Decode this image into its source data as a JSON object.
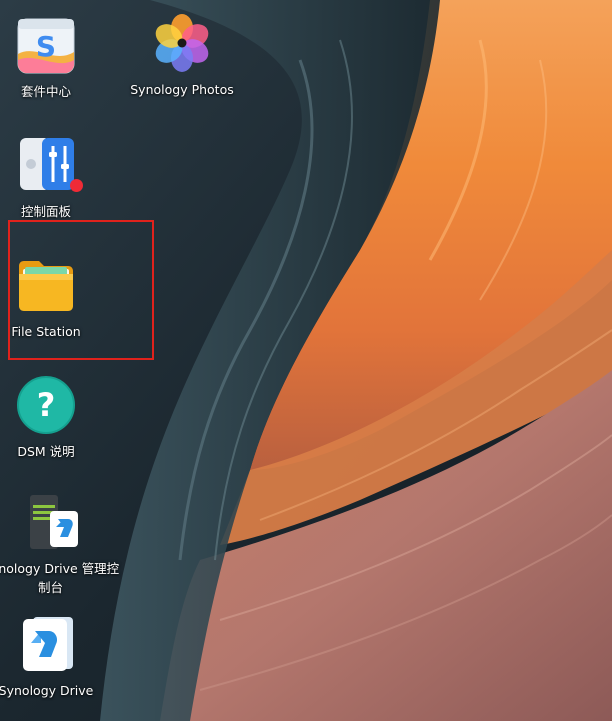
{
  "desktop": {
    "icons": [
      {
        "id": "package-center",
        "label": "套件中心",
        "icon": "package-center-icon"
      },
      {
        "id": "synology-photos",
        "label": "Synology Photos",
        "icon": "photos-flower-icon"
      },
      {
        "id": "control-panel",
        "label": "控制面板",
        "icon": "control-panel-sliders-icon",
        "badge": true
      },
      {
        "id": "file-station",
        "label": "File Station",
        "icon": "folder-icon",
        "highlighted": true
      },
      {
        "id": "dsm-help",
        "label": "DSM 说明",
        "icon": "help-question-icon"
      },
      {
        "id": "drive-admin-console",
        "label_line1": "Synology Drive 管理控",
        "label_line2": "制台",
        "icon": "drive-admin-console-icon"
      },
      {
        "id": "synology-drive",
        "label": "Synology Drive",
        "icon": "synology-drive-icon"
      }
    ],
    "colors": {
      "highlight_border": "#e0221c",
      "badge": "#ef2b36",
      "folder": "#f7b722",
      "help": "#1fb8a5",
      "drive": "#2a8fe0"
    }
  }
}
